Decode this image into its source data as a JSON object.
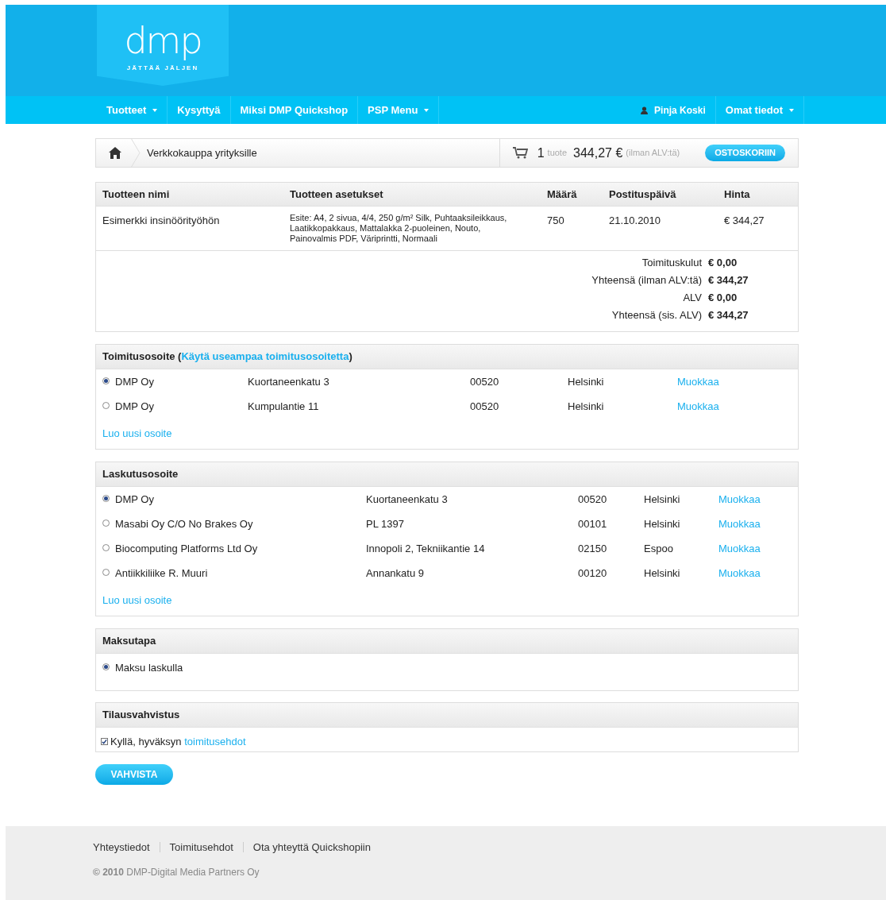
{
  "logo": {
    "wordmark": "dmp",
    "tagline": "JÄTTÄÄ JÄLJEN"
  },
  "nav": {
    "left": [
      {
        "label": "Tuotteet",
        "dropdown": true
      },
      {
        "label": "Kysyttyä",
        "dropdown": false
      },
      {
        "label": "Miksi DMP Quickshop",
        "dropdown": false
      },
      {
        "label": "PSP Menu",
        "dropdown": true
      }
    ],
    "user": "Pinja Koski",
    "right": [
      {
        "label": "Omat tiedot",
        "dropdown": true
      }
    ]
  },
  "breadcrumb": {
    "label": "Verkkokauppa yrityksille"
  },
  "cart": {
    "count": "1",
    "unit": "tuote",
    "total": "344,27 €",
    "note": "(ilman ALV:tä)",
    "button": "OSTOSKORIIN"
  },
  "order_table": {
    "columns": [
      "Tuotteen nimi",
      "Tuotteen asetukset",
      "Määrä",
      "Postituspäivä",
      "Hinta"
    ],
    "rows": [
      [
        "Esimerkki insinöörityöhön",
        "Esite: A4, 2 sivua, 4/4, 250 g/m² Silk, Puhtaaksileikkaus, Laatikkopakkaus, Mattalakka 2-puoleinen, Nouto, Painovalmis PDF, Väriprintti, Normaali",
        "750",
        "21.10.2010",
        "€ 344,27"
      ]
    ],
    "totals": [
      {
        "label": "Toimituskulut",
        "value": "€ 0,00"
      },
      {
        "label": "Yhteensä (ilman ALV:tä)",
        "value": "€ 344,27"
      },
      {
        "label": "ALV",
        "value": "€ 0,00"
      },
      {
        "label": "Yhteensä (sis. ALV)",
        "value": "€ 344,27"
      }
    ]
  },
  "delivery": {
    "title": "Toimitusosoite",
    "paren_open": "(",
    "link": "Käytä useampaa toimitusosoitetta",
    "paren_close": ")",
    "addresses": [
      {
        "name": "DMP Oy",
        "street": "Kuortaneenkatu 3",
        "zip": "00520",
        "city": "Helsinki",
        "edit": "Muokkaa",
        "selected": true
      },
      {
        "name": "DMP Oy",
        "street": "Kumpulantie 11",
        "zip": "00520",
        "city": "Helsinki",
        "edit": "Muokkaa",
        "selected": false
      }
    ],
    "new": "Luo uusi osoite"
  },
  "billing": {
    "title": "Laskutusosoite",
    "addresses": [
      {
        "name": "DMP Oy",
        "street": "Kuortaneenkatu 3",
        "zip": "00520",
        "city": "Helsinki",
        "edit": "Muokkaa",
        "selected": true
      },
      {
        "name": "Masabi Oy C/O No Brakes Oy",
        "street": "PL 1397",
        "zip": "00101",
        "city": "Helsinki",
        "edit": "Muokkaa",
        "selected": false
      },
      {
        "name": "Biocomputing Platforms Ltd Oy",
        "street": "Innopoli 2, Tekniikantie 14",
        "zip": "02150",
        "city": "Espoo",
        "edit": "Muokkaa",
        "selected": false
      },
      {
        "name": "Antiikkiliike R. Muuri",
        "street": "Annankatu 9",
        "zip": "00120",
        "city": "Helsinki",
        "edit": "Muokkaa",
        "selected": false
      }
    ],
    "new": "Luo uusi osoite"
  },
  "payment": {
    "title": "Maksutapa",
    "options": [
      {
        "label": "Maksu laskulla",
        "selected": true
      }
    ]
  },
  "confirmation": {
    "title": "Tilausvahvistus",
    "text": "Kyllä, hyväksyn",
    "link": "toimitusehdot",
    "checked": true
  },
  "submit": "VAHVISTA",
  "footer": {
    "links": [
      "Yhteystiedot",
      "Toimitusehdot",
      "Ota yhteyttä Quickshopiin"
    ],
    "copyright": "**© 2010** DMP-Digital Media Partners Oy"
  }
}
